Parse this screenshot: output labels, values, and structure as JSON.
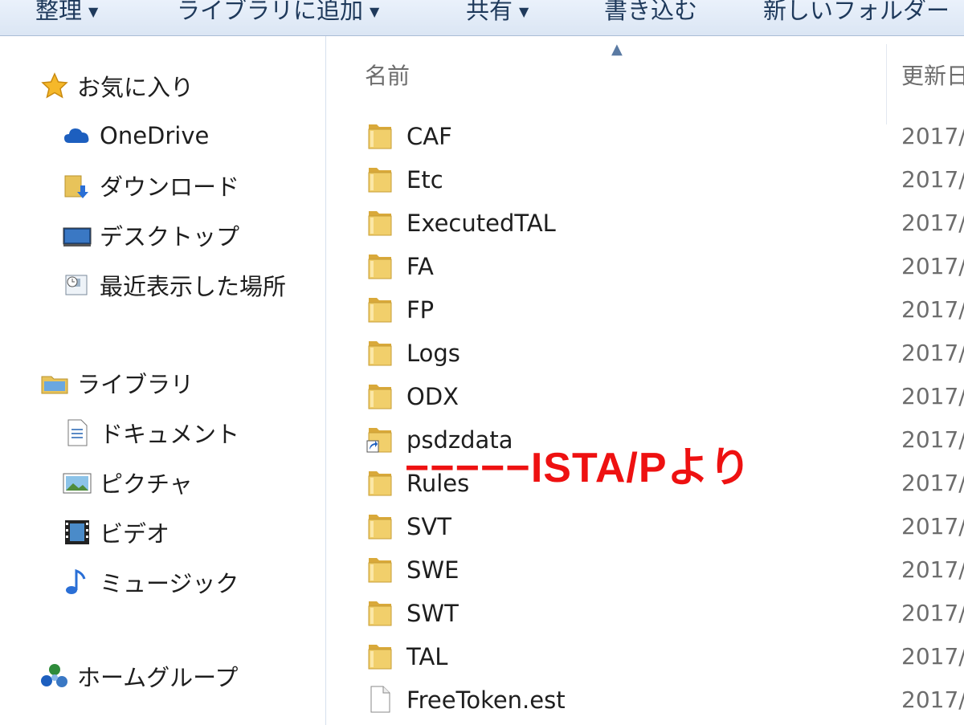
{
  "toolbar": {
    "organize": "整理",
    "add_to_library": "ライブラリに追加",
    "share": "共有",
    "burn": "書き込む",
    "new_folder": "新しいフォルダー"
  },
  "nav": {
    "favorites": "お気に入り",
    "onedrive": "OneDrive",
    "downloads": "ダウンロード",
    "desktop": "デスクトップ",
    "recent": "最近表示した場所",
    "libraries": "ライブラリ",
    "documents": "ドキュメント",
    "pictures": "ピクチャ",
    "videos": "ビデオ",
    "music": "ミュージック",
    "homegroup": "ホームグループ"
  },
  "columns": {
    "name": "名前",
    "modified": "更新日"
  },
  "files": [
    {
      "name": "CAF",
      "date": "2017/",
      "type": "folder"
    },
    {
      "name": "Etc",
      "date": "2017/",
      "type": "folder"
    },
    {
      "name": "ExecutedTAL",
      "date": "2017/",
      "type": "folder"
    },
    {
      "name": "FA",
      "date": "2017/",
      "type": "folder"
    },
    {
      "name": "FP",
      "date": "2017/",
      "type": "folder"
    },
    {
      "name": "Logs",
      "date": "2017/",
      "type": "folder"
    },
    {
      "name": "ODX",
      "date": "2017/",
      "type": "folder"
    },
    {
      "name": "psdzdata",
      "date": "2017/",
      "type": "shortcut"
    },
    {
      "name": "Rules",
      "date": "2017/",
      "type": "folder"
    },
    {
      "name": "SVT",
      "date": "2017/",
      "type": "folder"
    },
    {
      "name": "SWE",
      "date": "2017/",
      "type": "folder"
    },
    {
      "name": "SWT",
      "date": "2017/",
      "type": "folder"
    },
    {
      "name": "TAL",
      "date": "2017/",
      "type": "folder"
    },
    {
      "name": "FreeToken.est",
      "date": "2017/",
      "type": "file"
    }
  ],
  "annotation": "−−−−−ISTA/Pより",
  "colors": {
    "toolbar_text": "#1e395b",
    "annotation": "#ee1111",
    "folder": "#e8c35a"
  }
}
